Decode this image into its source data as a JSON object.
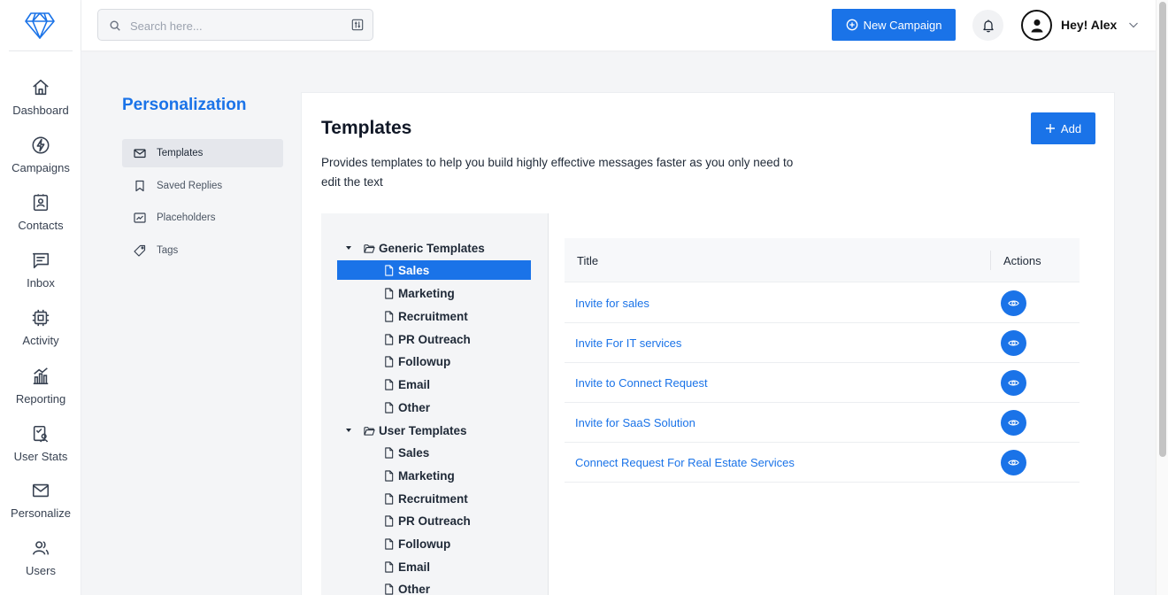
{
  "rail": {
    "items": [
      {
        "label": "Dashboard",
        "icon": "home-icon"
      },
      {
        "label": "Campaigns",
        "icon": "lightning-icon"
      },
      {
        "label": "Contacts",
        "icon": "contact-card-icon"
      },
      {
        "label": "Inbox",
        "icon": "message-icon"
      },
      {
        "label": "Activity",
        "icon": "chip-icon"
      },
      {
        "label": "Reporting",
        "icon": "chart-icon"
      },
      {
        "label": "User Stats",
        "icon": "user-stats-icon"
      },
      {
        "label": "Personalize",
        "icon": "envelope-icon"
      },
      {
        "label": "Users",
        "icon": "users-icon"
      }
    ]
  },
  "topbar": {
    "search_placeholder": "Search here...",
    "new_campaign_label": "New Campaign",
    "username": "Hey! Alex"
  },
  "subnav": {
    "title": "Personalization",
    "items": [
      {
        "label": "Templates",
        "active": true
      },
      {
        "label": "Saved Replies"
      },
      {
        "label": "Placeholders"
      },
      {
        "label": "Tags"
      }
    ]
  },
  "main": {
    "title": "Templates",
    "description": "Provides templates to help you build highly effective messages faster as you only need to edit the text",
    "add_label": "Add"
  },
  "tree": {
    "groups": [
      {
        "label": "Generic Templates",
        "items": [
          "Sales",
          "Marketing",
          "Recruitment",
          "PR Outreach",
          "Followup",
          "Email",
          "Other"
        ]
      },
      {
        "label": "User Templates",
        "items": [
          "Sales",
          "Marketing",
          "Recruitment",
          "PR Outreach",
          "Followup",
          "Email",
          "Other"
        ]
      }
    ],
    "selected": "Generic Templates / Sales"
  },
  "table": {
    "columns": [
      "Title",
      "Actions"
    ],
    "rows": [
      {
        "title": "Invite for sales"
      },
      {
        "title": "Invite For IT services"
      },
      {
        "title": "Invite to Connect Request"
      },
      {
        "title": "Invite for SaaS Solution"
      },
      {
        "title": "Connect Request For Real Estate Services"
      }
    ]
  },
  "colors": {
    "accent": "#1a73e8",
    "background": "#f4f5f7"
  }
}
